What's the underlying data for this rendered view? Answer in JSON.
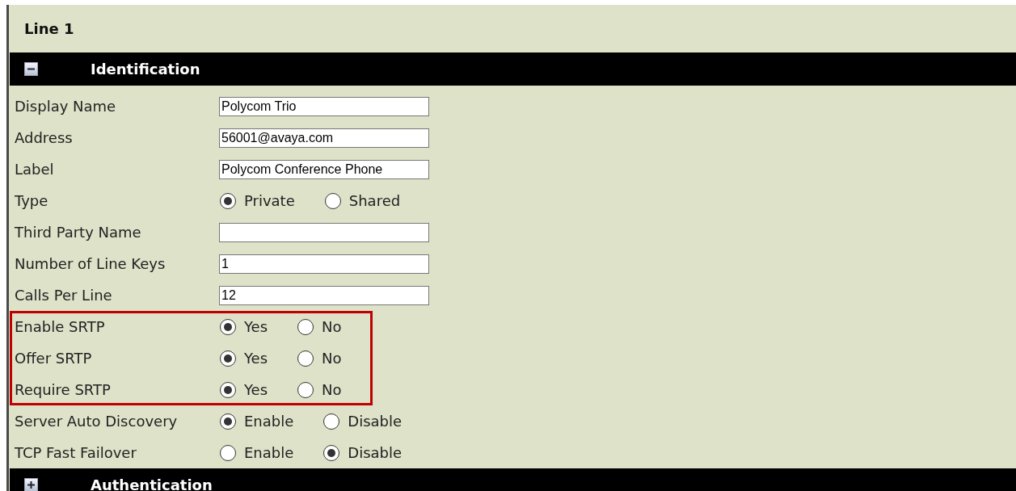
{
  "title": "Line 1",
  "sections": [
    {
      "title": "Identification",
      "expanded": true,
      "groups": [
        {
          "highlighted": false,
          "fields": [
            {
              "kind": "text",
              "label": "Display Name",
              "value": "Polycom Trio"
            },
            {
              "kind": "text",
              "label": "Address",
              "value": "56001@avaya.com"
            },
            {
              "kind": "text",
              "label": "Label",
              "value": "Polycom Conference Phone"
            },
            {
              "kind": "radio",
              "label": "Type",
              "options": [
                {
                  "label": "Private",
                  "selected": true
                },
                {
                  "label": "Shared",
                  "selected": false
                }
              ]
            },
            {
              "kind": "text",
              "label": "Third Party Name"
            },
            {
              "kind": "text",
              "label": "Number of Line Keys",
              "value": "1"
            },
            {
              "kind": "text",
              "label": "Calls Per Line",
              "value": "12"
            }
          ]
        },
        {
          "highlighted": true,
          "fields": [
            {
              "kind": "radio",
              "label": "Enable SRTP",
              "options": [
                {
                  "label": "Yes",
                  "selected": true
                },
                {
                  "label": "No",
                  "selected": false
                }
              ]
            },
            {
              "kind": "radio",
              "label": "Offer SRTP",
              "options": [
                {
                  "label": "Yes",
                  "selected": true
                },
                {
                  "label": "No",
                  "selected": false
                }
              ]
            },
            {
              "kind": "radio",
              "label": "Require SRTP",
              "options": [
                {
                  "label": "Yes",
                  "selected": true
                },
                {
                  "label": "No",
                  "selected": false
                }
              ]
            }
          ]
        },
        {
          "highlighted": false,
          "fields": [
            {
              "kind": "radio",
              "label": "Server Auto Discovery",
              "options": [
                {
                  "label": "Enable",
                  "selected": true
                },
                {
                  "label": "Disable",
                  "selected": false
                }
              ]
            },
            {
              "kind": "radio",
              "label": "TCP Fast Failover",
              "options": [
                {
                  "label": "Enable",
                  "selected": false
                },
                {
                  "label": "Disable",
                  "selected": true
                }
              ]
            }
          ]
        }
      ]
    },
    {
      "title": "Authentication",
      "expanded": false
    }
  ]
}
